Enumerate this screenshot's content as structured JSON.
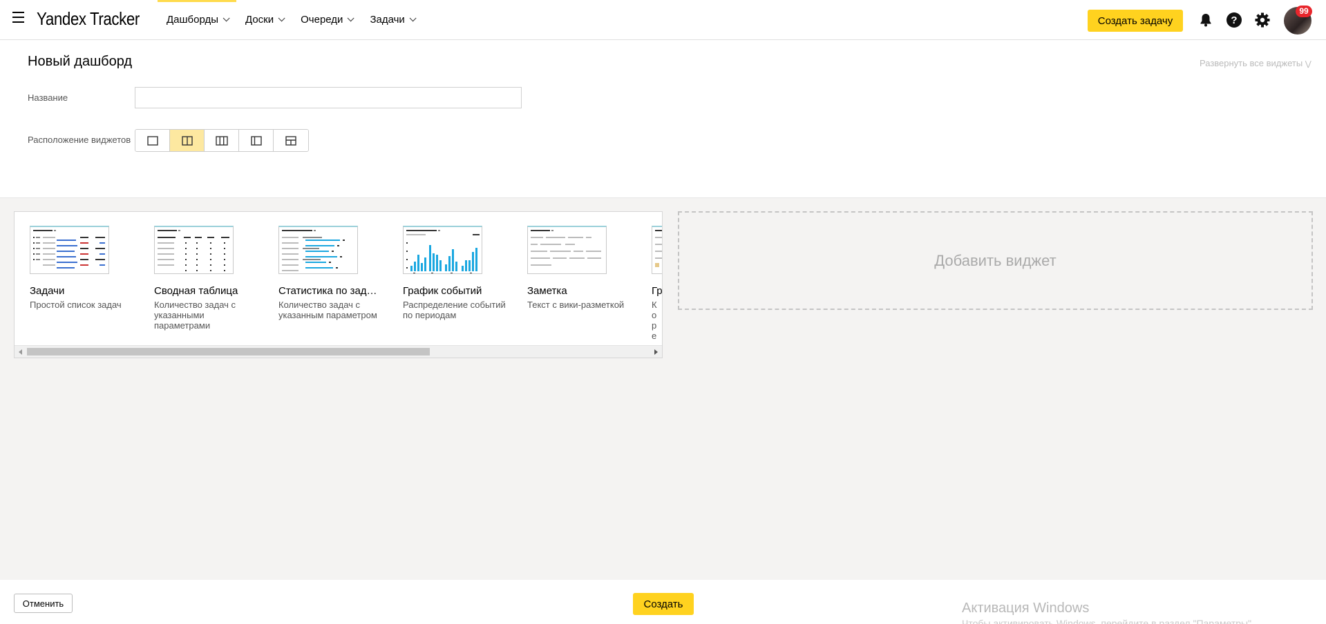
{
  "header": {
    "logo": "Yandex Tracker",
    "nav": [
      {
        "label": "Дашборды",
        "active": true
      },
      {
        "label": "Доски",
        "active": false
      },
      {
        "label": "Очереди",
        "active": false
      },
      {
        "label": "Задачи",
        "active": false
      }
    ],
    "create_task_label": "Создать задачу",
    "notifications_badge": "99",
    "icons": [
      "menu-icon",
      "bell-icon",
      "help-icon",
      "gear-icon"
    ]
  },
  "form": {
    "title": "Новый дашборд",
    "expand_all_label": "Развернуть все виджеты",
    "name_label": "Название",
    "name_value": "",
    "layout_label": "Расположение виджетов",
    "layout_options": [
      "one-column",
      "two-columns",
      "three-columns",
      "narrow-wide",
      "top-split"
    ],
    "layout_selected": "two-columns"
  },
  "palette": {
    "widgets": [
      {
        "title": "Задачи",
        "description": "Простой список задач"
      },
      {
        "title": "Сводная таблица",
        "description": "Количество задач с указанными параметрами"
      },
      {
        "title": "Статистика по зад…",
        "description": "Количество задач с указанным параметром"
      },
      {
        "title": "График событий",
        "description": "Распределение событий по периодам"
      },
      {
        "title": "Заметка",
        "description": "Текст с вики-разметкой"
      },
      {
        "title": "Гр",
        "description": "Ко ре"
      }
    ],
    "scroll_fraction_visible": 0.62
  },
  "add_widget_label": "Добавить виджет",
  "footer": {
    "cancel_label": "Отменить",
    "create_label": "Создать",
    "windows_activation": "Активация Windows",
    "windows_activation_sub": "Чтобы активировать Windows, перейдите в раздел \"Параметры\"."
  },
  "colors": {
    "accent": "#ffd21f",
    "nav_active": "#ffdb4d",
    "badge": "#e8262c",
    "chart_blue": "#1aa7e0",
    "workspace_bg": "#f4f3f2"
  }
}
